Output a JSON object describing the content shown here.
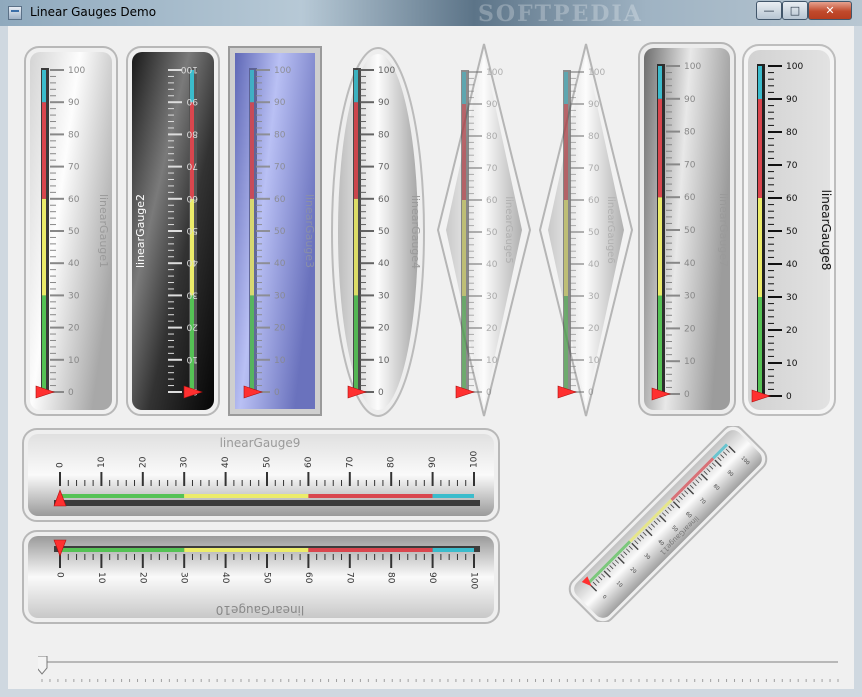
{
  "window": {
    "title": "Linear Gauges Demo",
    "watermark": "SOFTPEDIA",
    "minimize_glyph": "—",
    "maximize_glyph": "□",
    "close_glyph": "✕"
  },
  "scale": {
    "min": 0,
    "max": 100,
    "labels": [
      "0",
      "10",
      "20",
      "30",
      "40",
      "50",
      "60",
      "70",
      "80",
      "90",
      "100"
    ],
    "value": 0
  },
  "ranges": [
    {
      "from": 0,
      "to": 30,
      "color": "#55c255"
    },
    {
      "from": 30,
      "to": 60,
      "color": "#ecec6a"
    },
    {
      "from": 60,
      "to": 90,
      "color": "#d9464e"
    },
    {
      "from": 90,
      "to": 100,
      "color": "#3bbccc"
    }
  ],
  "gauges": [
    {
      "id": "g1",
      "name": "linearGauge1",
      "label": "linearGauge1"
    },
    {
      "id": "g2",
      "name": "linearGauge2",
      "label": "linearGauge2"
    },
    {
      "id": "g3",
      "name": "linearGauge3",
      "label": "linearGauge3"
    },
    {
      "id": "g4",
      "name": "linearGauge4",
      "label": "linearGauge4"
    },
    {
      "id": "g5",
      "name": "linearGauge5",
      "label": "linearGauge5"
    },
    {
      "id": "g6",
      "name": "linearGauge6",
      "label": "linearGauge6"
    },
    {
      "id": "g7",
      "name": "linearGauge7",
      "label": "linearGauge7"
    },
    {
      "id": "g8",
      "name": "linearGauge8",
      "label": "linearGauge8"
    },
    {
      "id": "g9",
      "name": "linearGauge9",
      "label": "linearGauge9"
    },
    {
      "id": "g10",
      "name": "linearGauge10",
      "label": "linearGauge10"
    },
    {
      "id": "g11",
      "name": "linearGauge11",
      "label": "linearGauge11"
    }
  ],
  "slider": {
    "value": 0,
    "min": 0,
    "max": 100
  },
  "colors": {
    "pointer": "#ff3030",
    "tick": "#333333",
    "face_light": "#f6f6f6",
    "face_dark": "#9a9a9a",
    "face_blue": "#8c95d8"
  }
}
